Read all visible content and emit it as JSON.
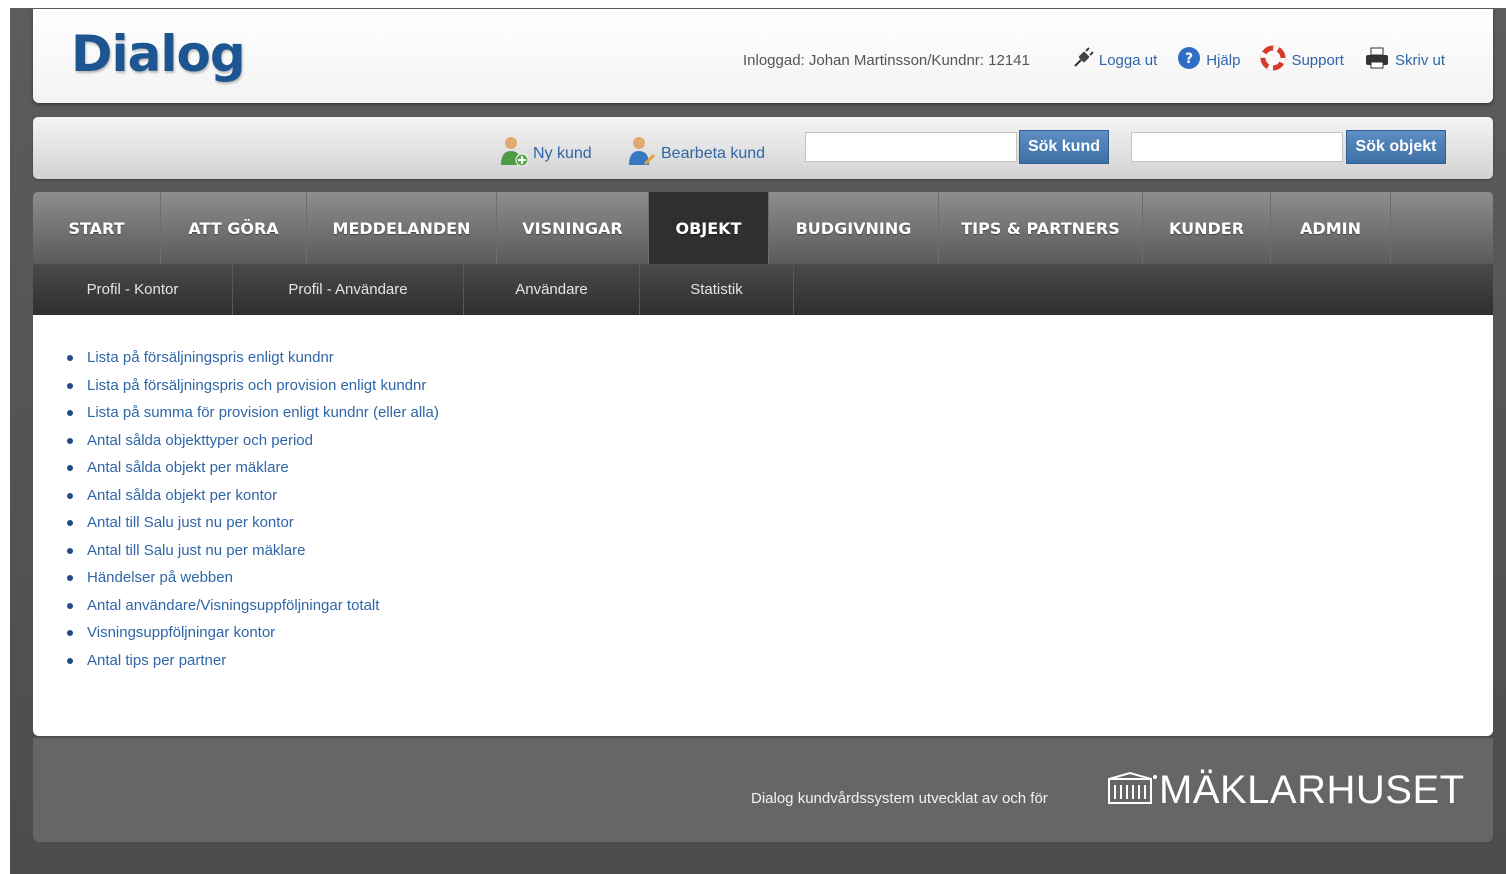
{
  "header": {
    "logo": "Dialog",
    "logged_in": "Inloggad: Johan Martinsson/Kundnr: 12141",
    "links": {
      "logout": "Logga ut",
      "help": "Hjälp",
      "support": "Support",
      "print": "Skriv ut"
    }
  },
  "searchbar": {
    "new_customer": "Ny kund",
    "edit_customer": "Bearbeta kund",
    "customer_search_value": "",
    "customer_search_button": "Sök kund",
    "object_search_value": "",
    "object_search_button": "Sök objekt"
  },
  "nav": {
    "tabs": [
      "START",
      "ATT GÖRA",
      "MEDDELANDEN",
      "VISNINGAR",
      "OBJEKT",
      "BUDGIVNING",
      "TIPS & PARTNERS",
      "KUNDER",
      "ADMIN"
    ],
    "active": "OBJEKT"
  },
  "subnav": {
    "items": [
      "Profil - Kontor",
      "Profil - Användare",
      "Användare",
      "Statistik"
    ]
  },
  "reports": [
    "Lista på försäljningspris enligt kundnr",
    "Lista på försäljningspris och provision enligt kundnr",
    "Lista på summa för provision enligt kundnr (eller alla)",
    "Antal sålda objekttyper och period",
    "Antal sålda objekt per mäklare",
    "Antal sålda objekt per kontor",
    "Antal till Salu just nu per kontor",
    "Antal till Salu just nu per mäklare",
    "Händelser på webben",
    "Antal användare/Visningsuppföljningar totalt",
    "Visningsuppföljningar kontor",
    "Antal tips per partner"
  ],
  "footer": {
    "text": "Dialog kundvårdssystem utvecklat av och för",
    "brand": "MÄKLARHUSET"
  },
  "colors": {
    "link": "#2f66a8",
    "logo": "#1d5592",
    "button": "#4a7db3",
    "nav_active": "#2f2f2f"
  }
}
